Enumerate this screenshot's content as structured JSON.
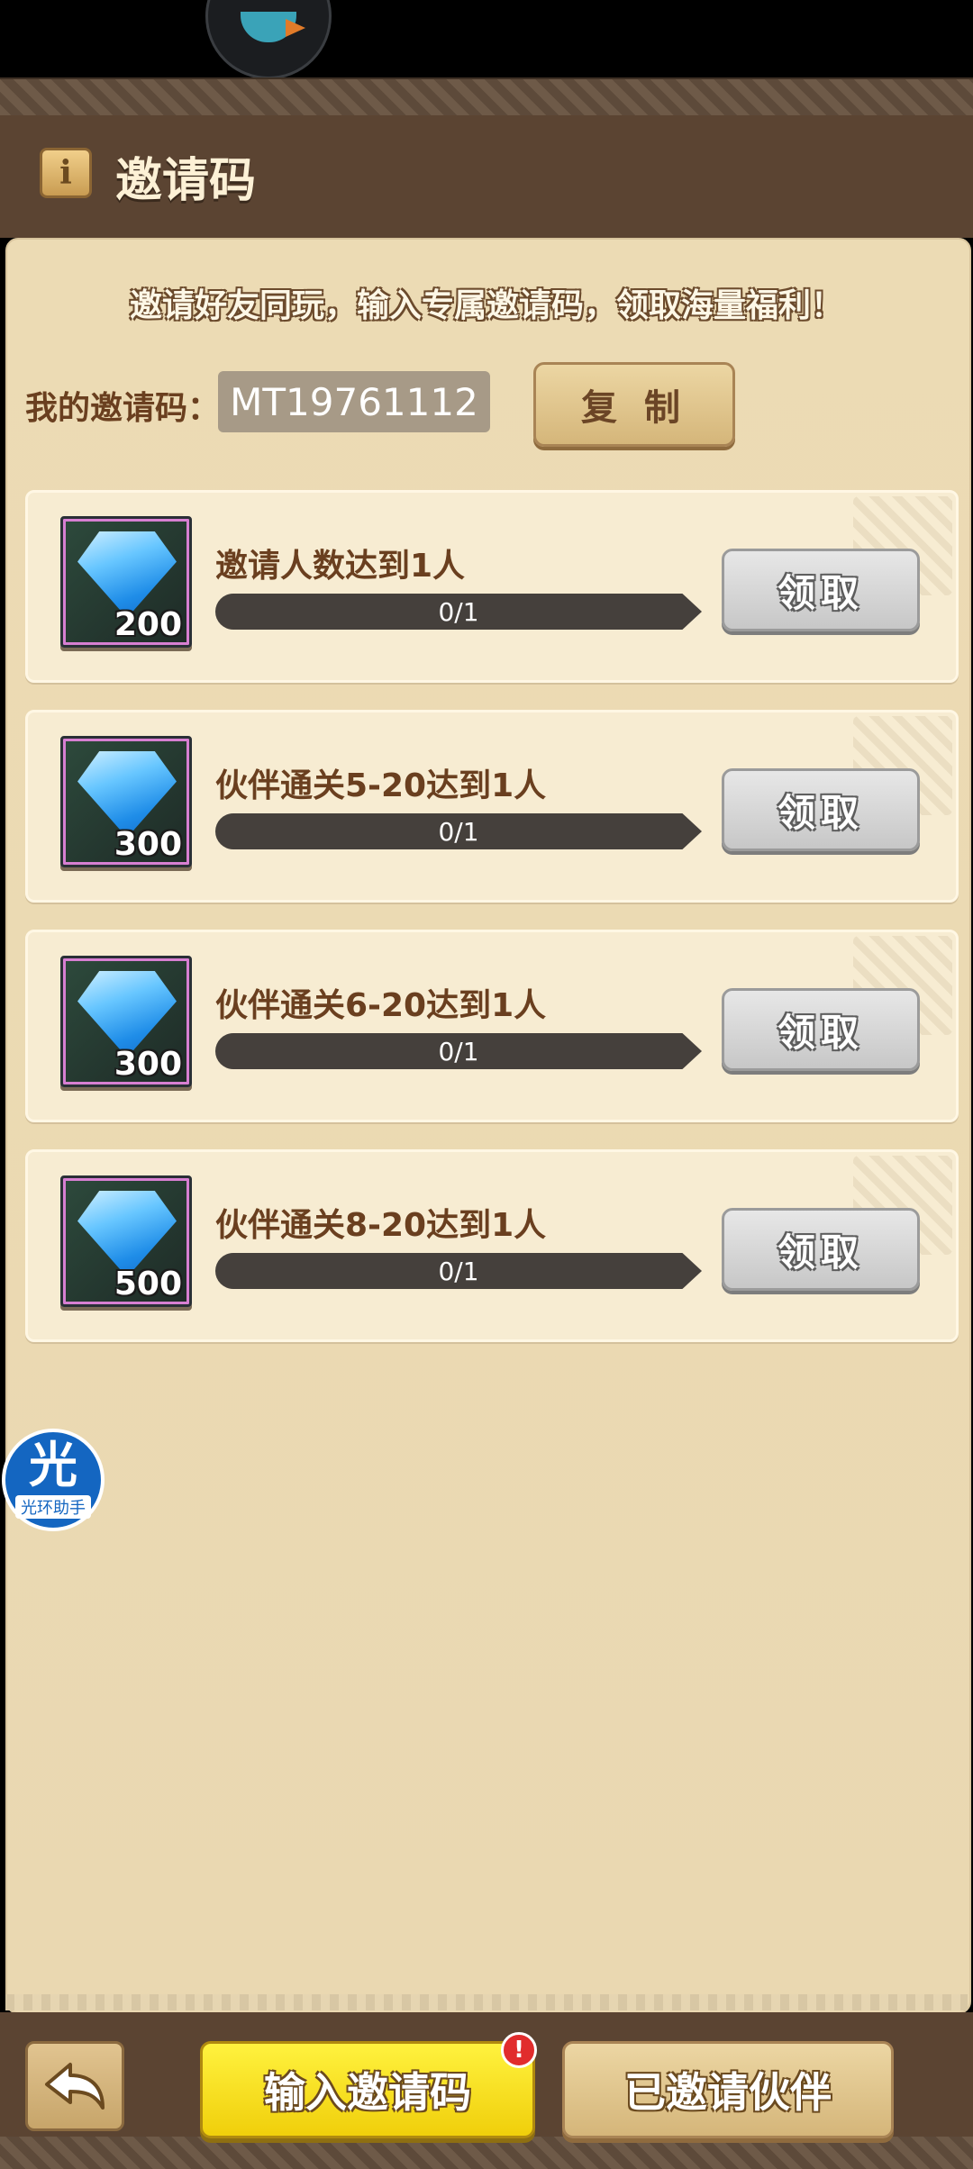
{
  "header": {
    "title": "邀请码",
    "info_icon": "info-icon"
  },
  "promo_text": "邀请好友同玩，输入专属邀请码，领取海量福利！",
  "invite": {
    "label": "我的邀请码：",
    "code": "MT19761112",
    "copy_label": "复 制"
  },
  "tasks": [
    {
      "title": "邀请人数达到1人",
      "reward": "200",
      "progress_text": "0/1",
      "progress": 0,
      "claim_label": "领取",
      "icon": "blue-gem-icon"
    },
    {
      "title": "伙伴通关5-20达到1人",
      "reward": "300",
      "progress_text": "0/1",
      "progress": 0,
      "claim_label": "领取",
      "icon": "blue-gem-icon"
    },
    {
      "title": "伙伴通关6-20达到1人",
      "reward": "300",
      "progress_text": "0/1",
      "progress": 0,
      "claim_label": "领取",
      "icon": "blue-gem-icon"
    },
    {
      "title": "伙伴通关8-20达到1人",
      "reward": "500",
      "progress_text": "0/1",
      "progress": 0,
      "claim_label": "领取",
      "icon": "blue-gem-icon"
    }
  ],
  "helper": {
    "glyph": "光",
    "label": "光环助手"
  },
  "bottom": {
    "enter_label": "输入邀请码",
    "alert": "!",
    "invited_label": "已邀请伙伴",
    "back_icon": "back-arrow-icon"
  },
  "colors": {
    "accent_yellow": "#f5e020",
    "panel_bg": "#ecdbb4",
    "header_bg": "#5b4432",
    "title_brown": "#6a3f1f"
  }
}
